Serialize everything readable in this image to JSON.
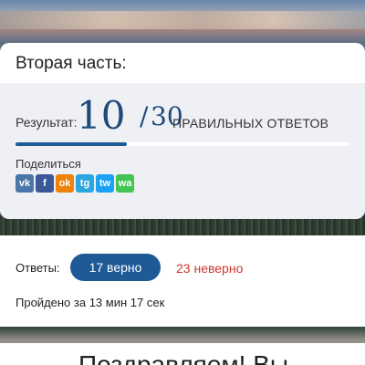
{
  "section": {
    "title": "Вторая часть:"
  },
  "result": {
    "label": "Результат:",
    "score": "10",
    "separator": "/",
    "total": "30",
    "suffix": "ПРАВИЛЬНЫХ ОТВЕТОВ",
    "progress_fraction": 0.333
  },
  "share": {
    "label": "Поделиться",
    "icons": [
      {
        "name": "vk-icon",
        "glyph": "vk",
        "color": "#4a76a8"
      },
      {
        "name": "facebook-icon",
        "glyph": "f",
        "color": "#3b5998"
      },
      {
        "name": "odnoklassniki-icon",
        "glyph": "ok",
        "color": "#ee8208"
      },
      {
        "name": "telegram-icon",
        "glyph": "tg",
        "color": "#2ca5e0"
      },
      {
        "name": "twitter-icon",
        "glyph": "tw",
        "color": "#1da1f2"
      },
      {
        "name": "whatsapp-icon",
        "glyph": "wa",
        "color": "#43c553"
      }
    ]
  },
  "answers": {
    "label": "Ответы:",
    "correct": "17 верно",
    "wrong": "23 неверно",
    "time": "Пройдено за 13 мин 17 сек"
  },
  "footer": {
    "congrats": "Поздравляем! Вы"
  },
  "colors": {
    "accent": "#1d5a96",
    "score": "#1d4a7c",
    "wrong": "#d0342c"
  }
}
